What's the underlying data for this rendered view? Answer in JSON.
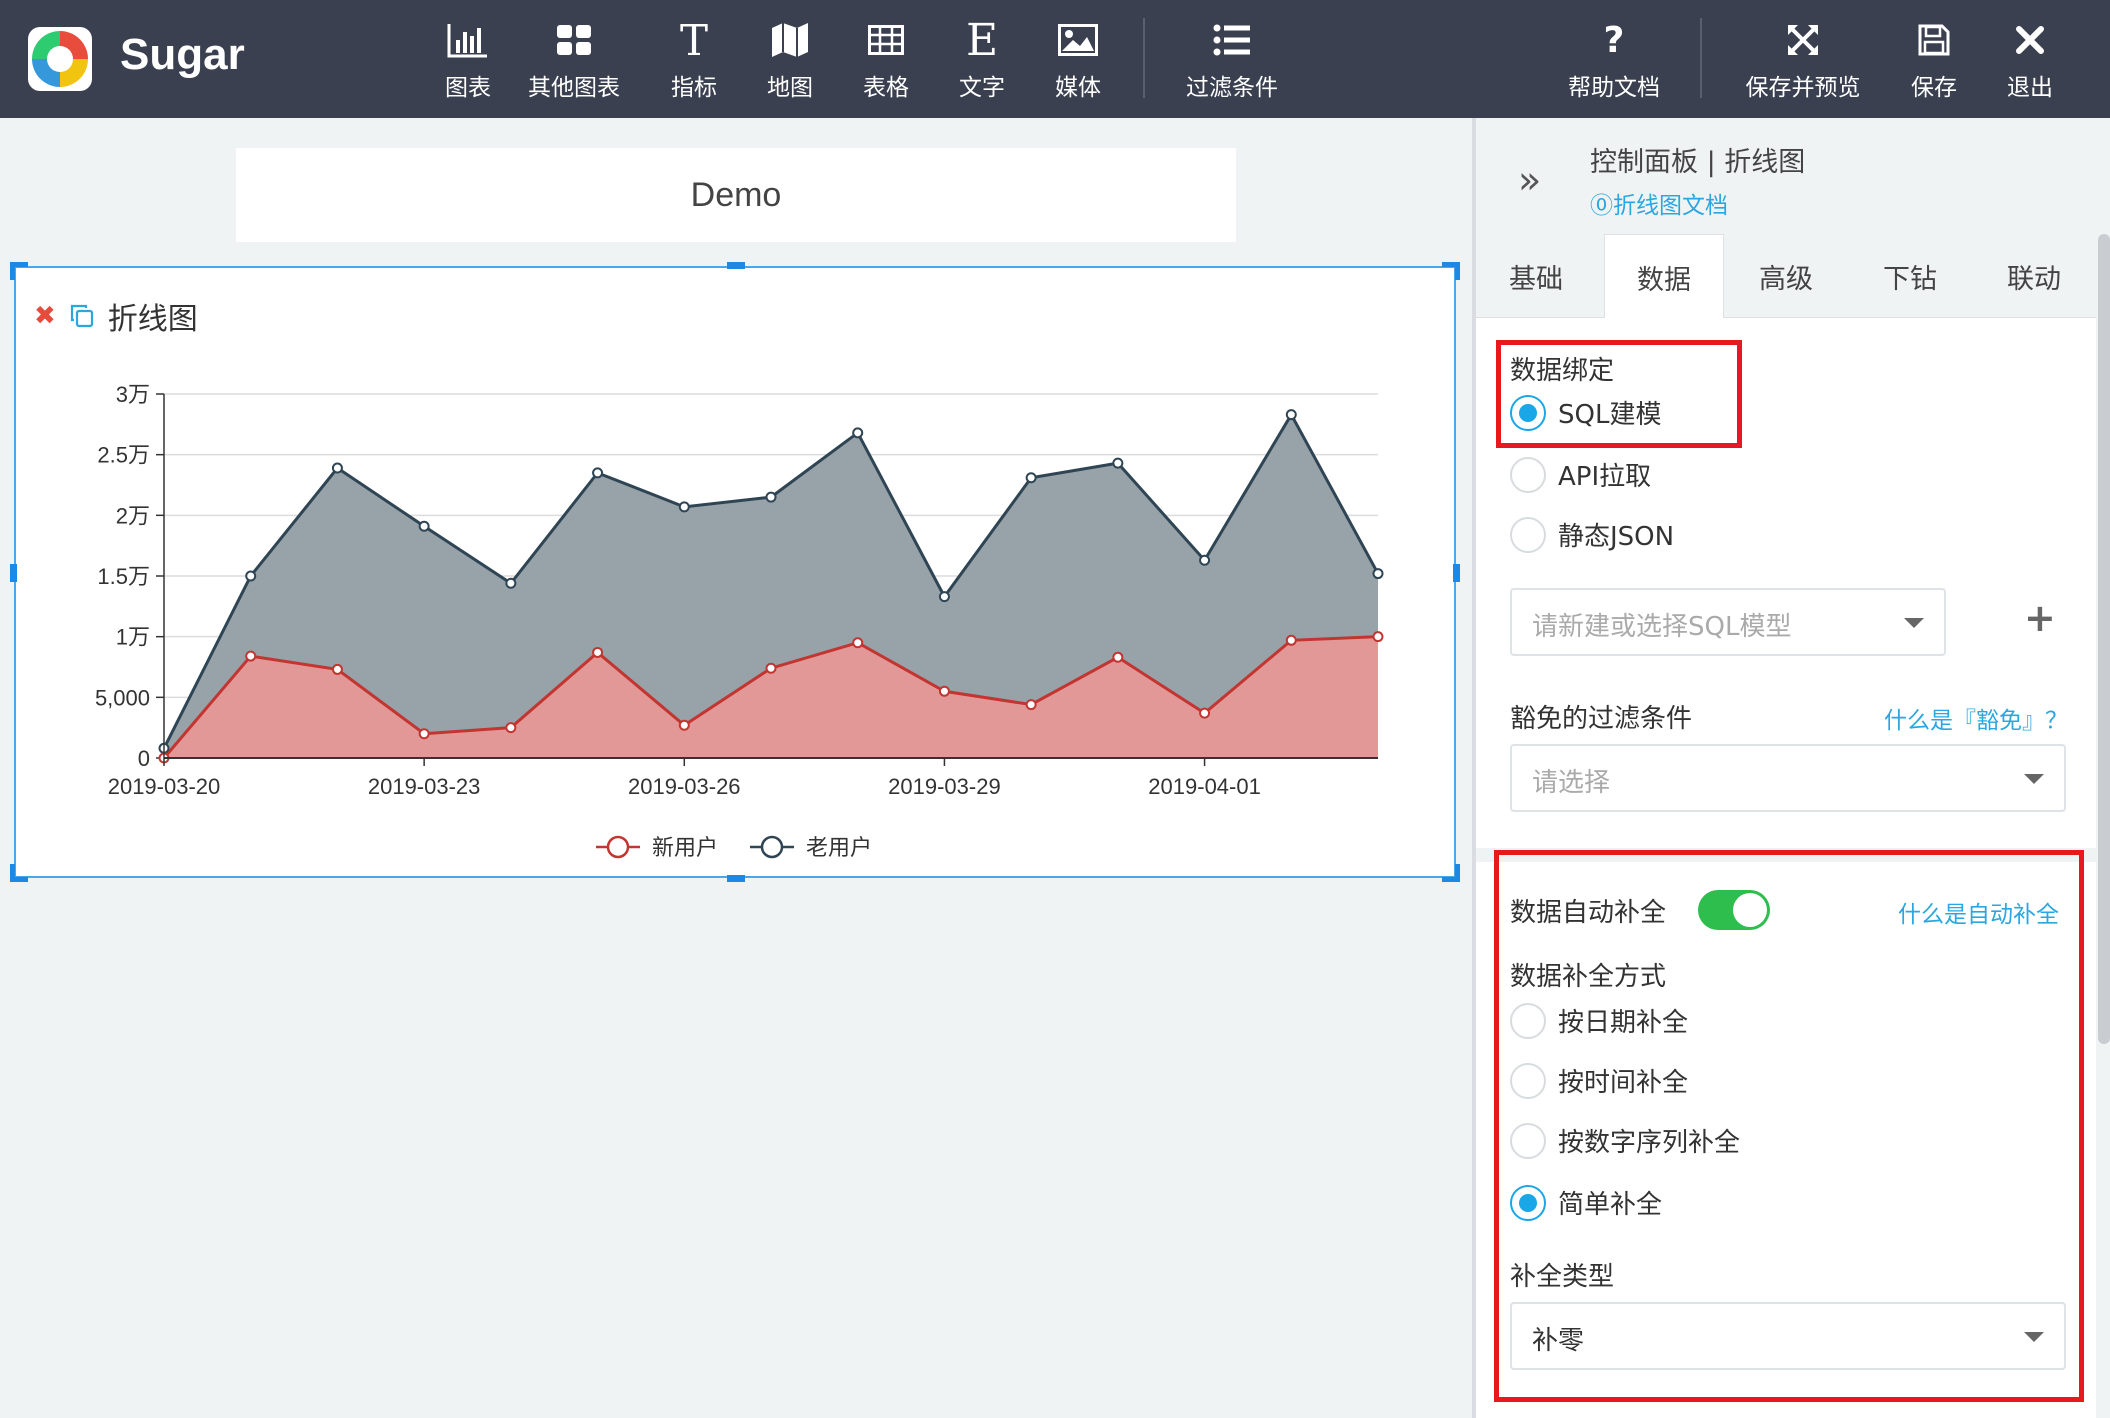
{
  "app": {
    "name": "Sugar"
  },
  "toolbar": {
    "items": [
      {
        "label": "图表",
        "icon": "bar-chart-icon"
      },
      {
        "label": "其他图表",
        "icon": "grid-icon"
      },
      {
        "label": "指标",
        "icon": "text-t-icon"
      },
      {
        "label": "地图",
        "icon": "map-icon"
      },
      {
        "label": "表格",
        "icon": "table-icon"
      },
      {
        "label": "文字",
        "icon": "text-e-icon"
      },
      {
        "label": "媒体",
        "icon": "image-icon"
      },
      {
        "label": "过滤条件",
        "icon": "list-icon"
      }
    ],
    "right_items": [
      {
        "label": "帮助文档",
        "icon": "help-icon"
      },
      {
        "label": "保存并预览",
        "icon": "expand-icon"
      },
      {
        "label": "保存",
        "icon": "save-icon"
      },
      {
        "label": "退出",
        "icon": "close-icon"
      }
    ]
  },
  "canvas": {
    "title": "Demo",
    "card_title": "折线图"
  },
  "chart_data": {
    "type": "area",
    "title": "",
    "x": [
      "2019-03-20",
      "2019-03-21",
      "2019-03-22",
      "2019-03-23",
      "2019-03-24",
      "2019-03-25",
      "2019-03-26",
      "2019-03-27",
      "2019-03-28",
      "2019-03-29",
      "2019-03-30",
      "2019-03-31",
      "2019-04-01",
      "2019-04-02",
      "2019-04-03"
    ],
    "x_tick_labels": [
      "2019-03-20",
      "2019-03-23",
      "2019-03-26",
      "2019-03-29",
      "2019-04-01"
    ],
    "y_tick_labels": [
      "0",
      "5,000",
      "1万",
      "1.5万",
      "2万",
      "2.5万",
      "3万"
    ],
    "ylim": [
      0,
      30000
    ],
    "stacked": true,
    "series": [
      {
        "name": "新用户",
        "color": "#c23531",
        "values": [
          0,
          8400,
          7300,
          2000,
          2500,
          8700,
          2700,
          7400,
          9500,
          5500,
          4400,
          8300,
          3700,
          9700,
          10000
        ]
      },
      {
        "name": "老用户",
        "color": "#2f4554",
        "values": [
          800,
          6600,
          16600,
          17100,
          11900,
          14800,
          18000,
          14100,
          17300,
          7800,
          18700,
          16000,
          12600,
          18600,
          5200
        ]
      }
    ],
    "legend_position": "bottom-center"
  },
  "panel": {
    "title": "控制面板 | 折线图",
    "doc_link": "⓪折线图文档",
    "tabs": [
      "基础",
      "数据",
      "高级",
      "下钻",
      "联动"
    ],
    "active_tab": "数据",
    "binding_label": "数据绑定",
    "binding_options": [
      "SQL建模",
      "API拉取",
      "静态JSON"
    ],
    "binding_selected": "SQL建模",
    "sql_model_placeholder": "请新建或选择SQL模型",
    "exempt_filter_label": "豁免的过滤条件",
    "exempt_help": "什么是『豁免』？",
    "exempt_placeholder": "请选择",
    "autofill_label": "数据自动补全",
    "autofill_help": "什么是自动补全",
    "autofill_on": true,
    "fill_method_label": "数据补全方式",
    "fill_methods": [
      "按日期补全",
      "按时间补全",
      "按数字序列补全",
      "简单补全"
    ],
    "fill_method_selected": "简单补全",
    "fill_type_label": "补全类型",
    "fill_type_value": "补零"
  },
  "colors": {
    "topbar": "#3a4050",
    "accent": "#1aa7e8",
    "highlight_box": "#e8191e",
    "toggle_on": "#2dbe4e"
  }
}
